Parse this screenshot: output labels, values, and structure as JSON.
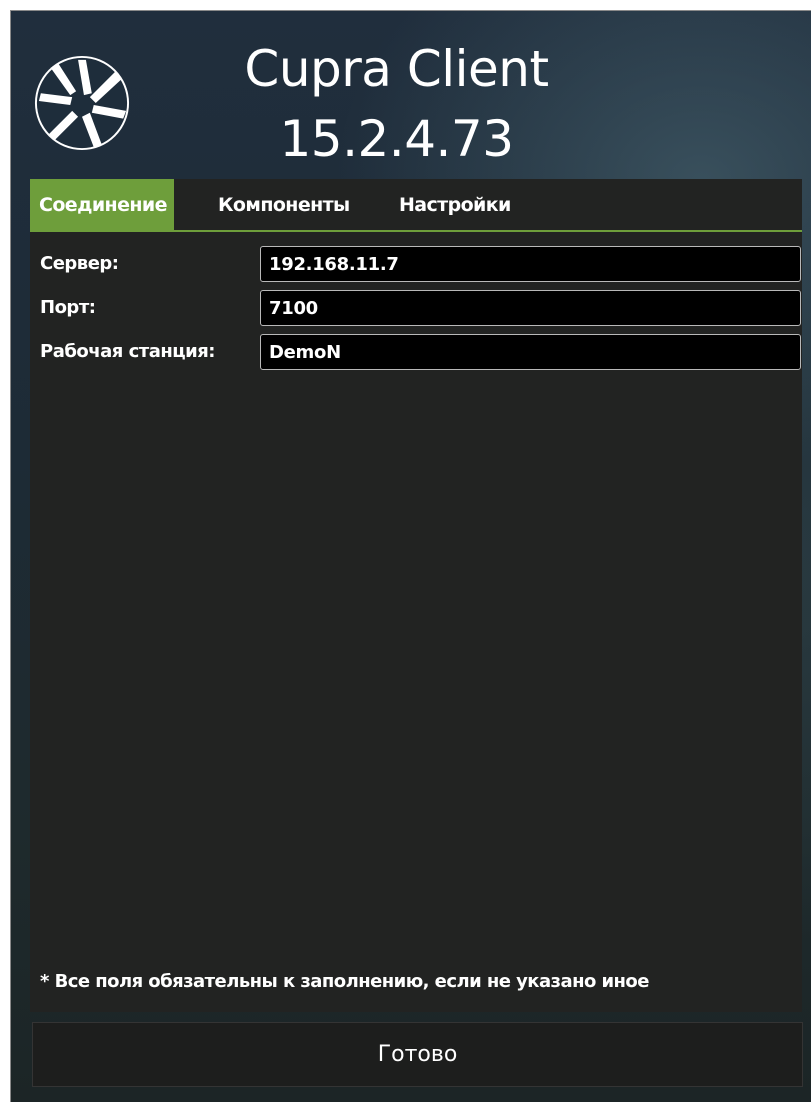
{
  "app": {
    "name": "Cupra Client",
    "version": "15.2.4.73",
    "logo_icon": "aperture-logo-icon"
  },
  "tabs": [
    {
      "label": "Соединение",
      "active": true
    },
    {
      "label": "Компоненты",
      "active": false
    },
    {
      "label": "Настройки",
      "active": false
    }
  ],
  "form": {
    "server": {
      "label": "Сервер:",
      "value": "192.168.11.7"
    },
    "port": {
      "label": "Порт:",
      "value": "7100"
    },
    "workstation": {
      "label": "Рабочая станция:",
      "value": "DemoN"
    }
  },
  "note": "* Все поля обязательны к заполнению, если не указано иное",
  "done_button": "Готово",
  "colors": {
    "accent": "#6e9e3b",
    "panel": "#222322",
    "input_bg": "#000000"
  }
}
